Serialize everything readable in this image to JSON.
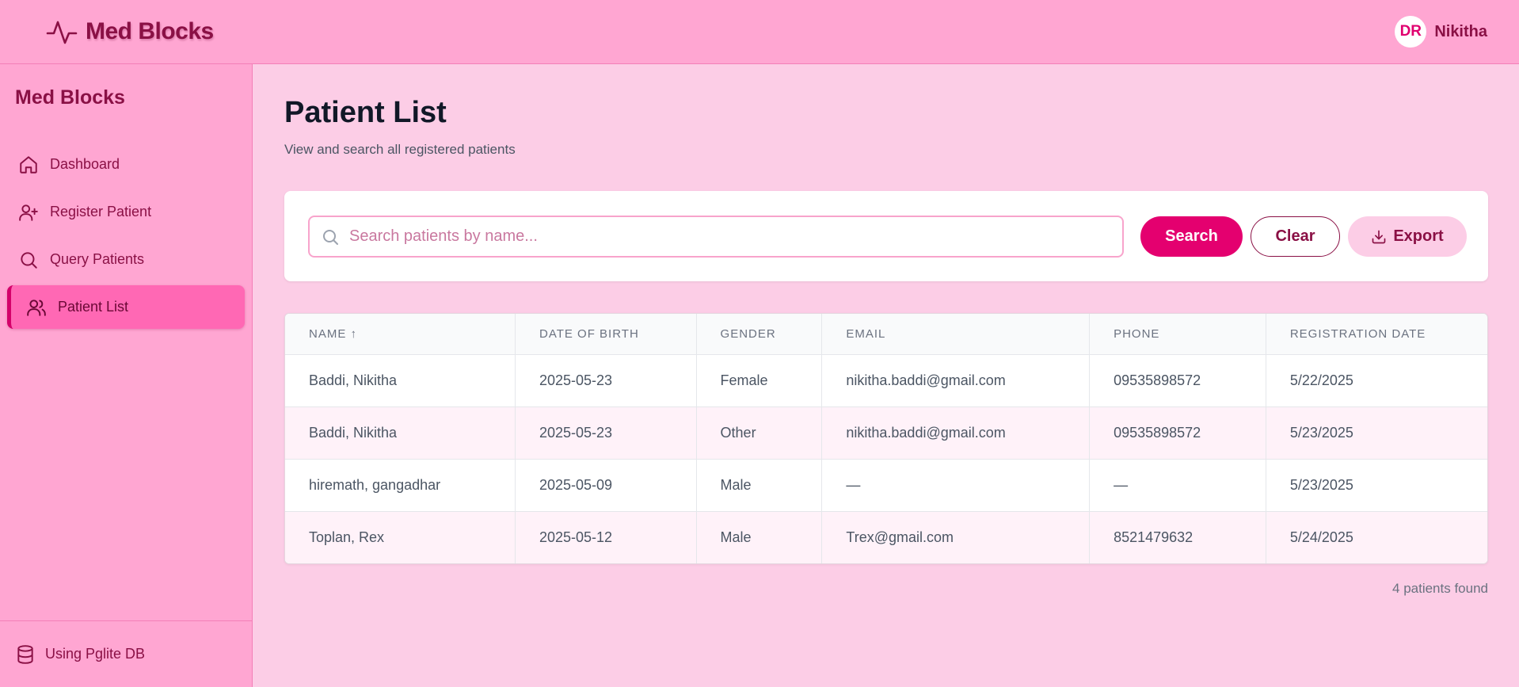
{
  "app": {
    "brand": "Med Blocks",
    "user_initials": "DR",
    "user_name": "Nikitha"
  },
  "colors": {
    "accent": "#e4006f",
    "brand_dark": "#8a1045",
    "header_bg": "#ffa6d2",
    "page_bg": "#fccde6"
  },
  "sidebar": {
    "title": "Med Blocks",
    "items": [
      {
        "label": "Dashboard",
        "icon": "home-icon",
        "active": false
      },
      {
        "label": "Register Patient",
        "icon": "user-plus-icon",
        "active": false
      },
      {
        "label": "Query Patients",
        "icon": "search-icon",
        "active": false
      },
      {
        "label": "Patient List",
        "icon": "users-icon",
        "active": true
      }
    ],
    "footer": "Using Pglite DB"
  },
  "main": {
    "title": "Patient List",
    "subtitle": "View and search all registered patients",
    "search": {
      "placeholder": "Search patients by name...",
      "value": ""
    },
    "buttons": {
      "search": "Search",
      "clear": "Clear",
      "export": "Export"
    },
    "table": {
      "columns": [
        "NAME ↑",
        "DATE OF BIRTH",
        "GENDER",
        "EMAIL",
        "PHONE",
        "REGISTRATION DATE"
      ],
      "rows": [
        [
          "Baddi, Nikitha",
          "2025-05-23",
          "Female",
          "nikitha.baddi@gmail.com",
          "09535898572",
          "5/22/2025"
        ],
        [
          "Baddi, Nikitha",
          "2025-05-23",
          "Other",
          "nikitha.baddi@gmail.com",
          "09535898572",
          "5/23/2025"
        ],
        [
          "hiremath, gangadhar",
          "2025-05-09",
          "Male",
          "—",
          "—",
          "5/23/2025"
        ],
        [
          "Toplan, Rex",
          "2025-05-12",
          "Male",
          "Trex@gmail.com",
          "8521479632",
          "5/24/2025"
        ]
      ]
    },
    "count_text": "4 patients found"
  }
}
